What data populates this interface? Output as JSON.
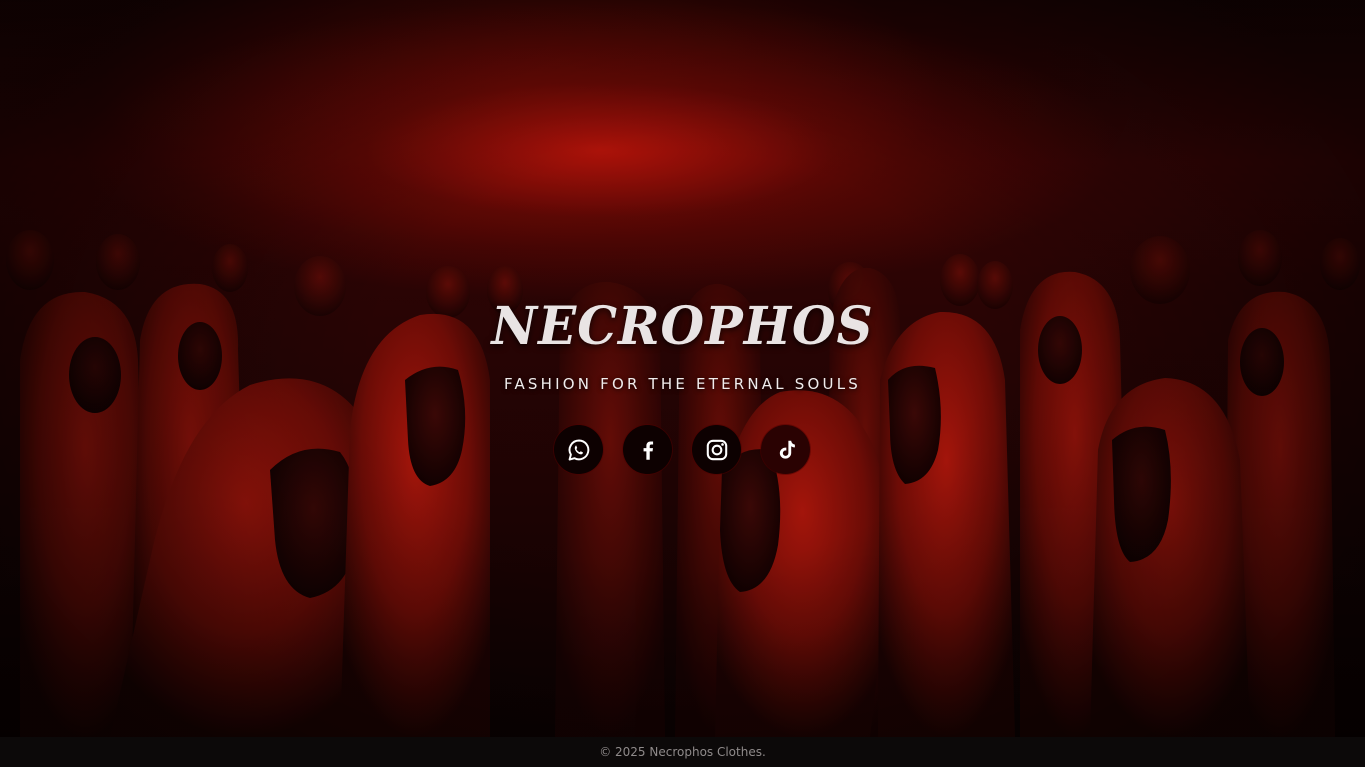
{
  "brand": {
    "name": "NECROPHOS",
    "tagline": "FASHION FOR THE ETERNAL SOULS"
  },
  "hero": {
    "background_image": "hooded-figures-crowd",
    "palette": {
      "accent": "#b3140a",
      "dark": "#0b0101"
    }
  },
  "socials": [
    {
      "name": "WhatsApp",
      "icon": "whatsapp-icon"
    },
    {
      "name": "Facebook",
      "icon": "facebook-icon"
    },
    {
      "name": "Instagram",
      "icon": "instagram-icon"
    },
    {
      "name": "TikTok",
      "icon": "tiktok-icon"
    }
  ],
  "footer": {
    "copyright": "© 2025 Necrophos Clothes."
  }
}
